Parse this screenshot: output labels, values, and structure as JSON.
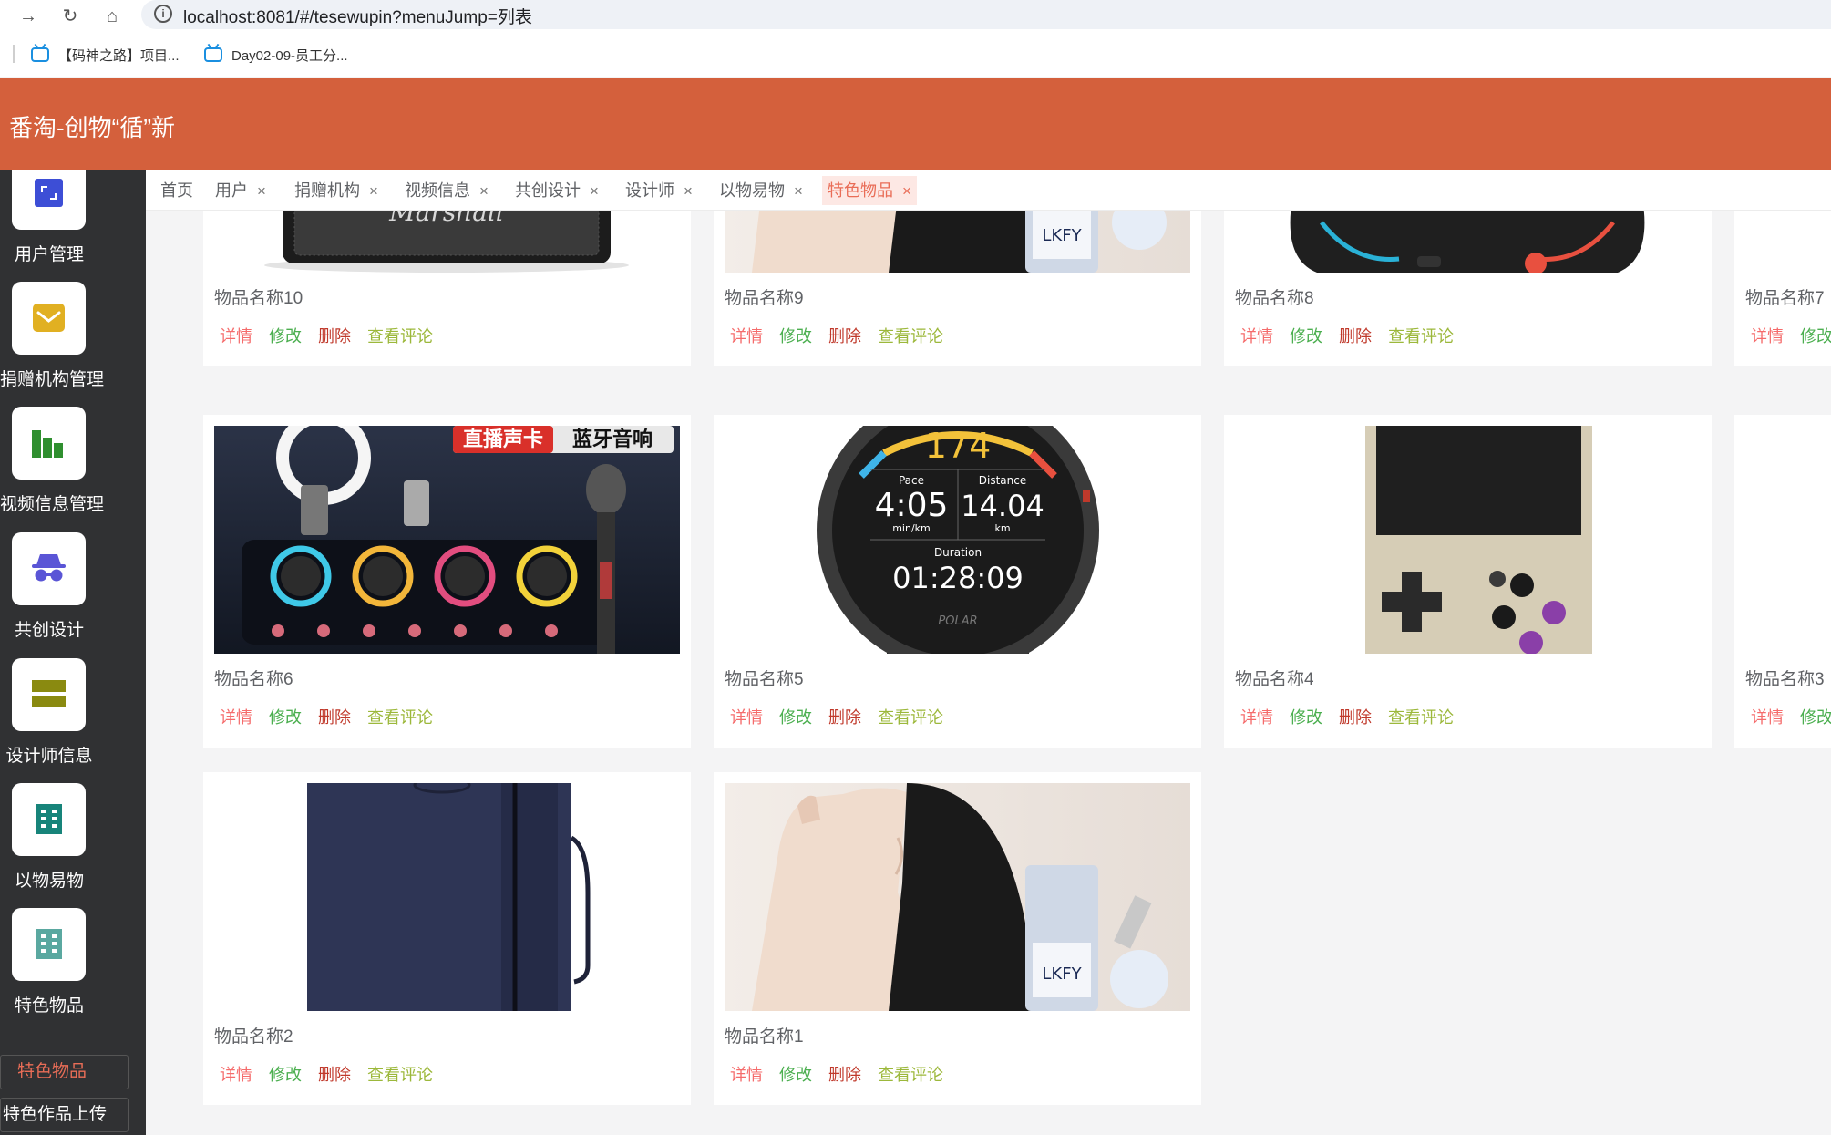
{
  "browser": {
    "url": "localhost:8081/#/tesewupin?menuJump=列表",
    "bookmarks": [
      "【码神之路】项目...",
      "Day02-09-员工分..."
    ]
  },
  "app": {
    "title": "番淘-创物“循”新"
  },
  "sidebar": {
    "items": [
      {
        "label": "用户管理",
        "icon": "user-management-icon",
        "color": "#3d4ed6"
      },
      {
        "label": "捐赠机构管理",
        "icon": "envelope-icon",
        "color": "#e1b022"
      },
      {
        "label": "视频信息管理",
        "icon": "bar-chart-icon",
        "color": "#2f8f2f"
      },
      {
        "label": "共创设计",
        "icon": "incognito-icon",
        "color": "#5a55d6"
      },
      {
        "label": "设计师信息",
        "icon": "layout-icon",
        "color": "#8a8a10"
      },
      {
        "label": "以物易物",
        "icon": "building-icon",
        "color": "#17847a"
      },
      {
        "label": "特色物品",
        "icon": "building-icon",
        "color": "#5aa8a0"
      }
    ],
    "submenu": [
      {
        "label": "特色物品",
        "active": true
      },
      {
        "label": "特色作品上传",
        "active": false
      }
    ]
  },
  "tabs": [
    {
      "label": "首页",
      "closable": false,
      "active": false
    },
    {
      "label": "用户",
      "closable": true,
      "active": false
    },
    {
      "label": "捐赠机构",
      "closable": true,
      "active": false
    },
    {
      "label": "视频信息",
      "closable": true,
      "active": false
    },
    {
      "label": "共创设计",
      "closable": true,
      "active": false
    },
    {
      "label": "设计师",
      "closable": true,
      "active": false
    },
    {
      "label": "以物易物",
      "closable": true,
      "active": false
    },
    {
      "label": "特色物品",
      "closable": true,
      "active": true
    }
  ],
  "actions": {
    "detail": "详情",
    "edit": "修改",
    "delete": "删除",
    "review": "查看评论"
  },
  "items": [
    {
      "name": "物品名称10",
      "image": "speaker"
    },
    {
      "name": "物品名称9",
      "image": "skincare"
    },
    {
      "name": "物品名称8",
      "image": "gamepad"
    },
    {
      "name": "物品名称7",
      "image": "blank"
    },
    {
      "name": "物品名称6",
      "image": "karaoke-speaker",
      "banner": [
        "直播声卡",
        "蓝牙音响"
      ]
    },
    {
      "name": "物品名称5",
      "image": "sport-watch",
      "watch": {
        "heart": "174",
        "pace_label": "Pace",
        "pace": "4:05",
        "pace_unit": "min/km",
        "dist_label": "Distance",
        "dist": "14.04",
        "dist_unit": "km",
        "dur_label": "Duration",
        "dur": "01:28:09",
        "brand": "POLAR"
      }
    },
    {
      "name": "物品名称4",
      "image": "handheld-console"
    },
    {
      "name": "物品名称3",
      "image": "blank"
    },
    {
      "name": "物品名称2",
      "image": "bag"
    },
    {
      "name": "物品名称1",
      "image": "skincare"
    }
  ],
  "product_brand": "LKFY"
}
